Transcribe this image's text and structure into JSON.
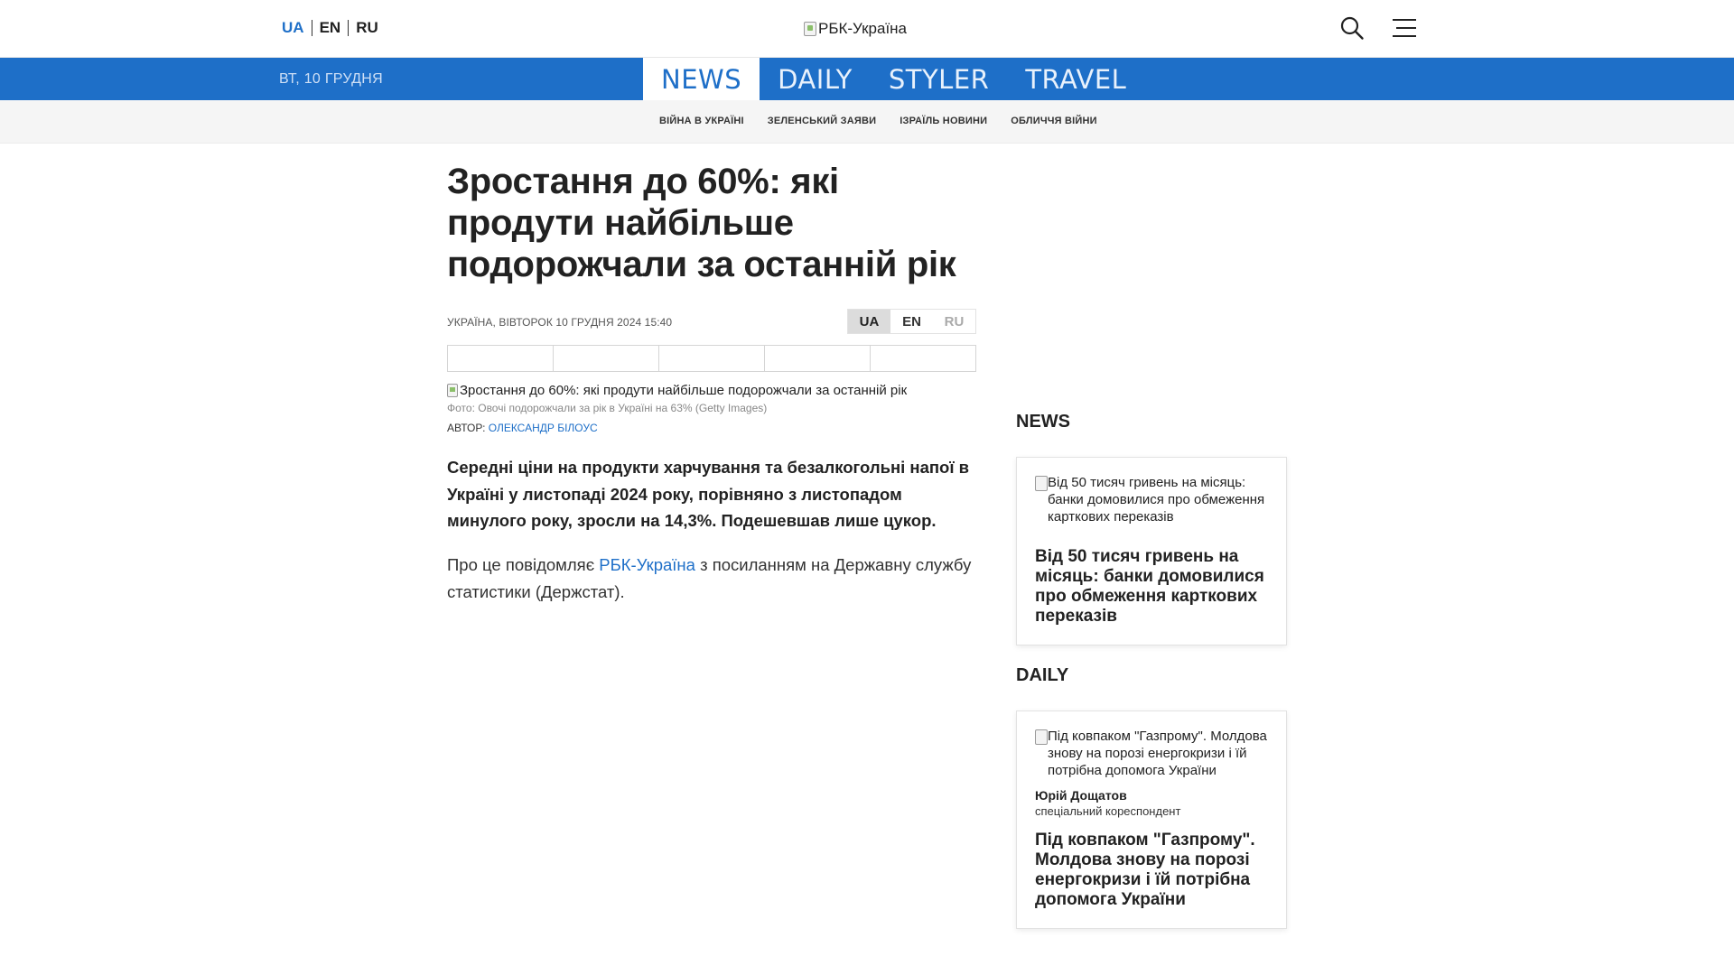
{
  "header": {
    "languages": [
      "UA",
      "EN",
      "RU"
    ],
    "active_language": "UA",
    "logo_alt": "РБК-Україна"
  },
  "nav": {
    "date": "ВТ, 10 ГРУДНЯ",
    "sections": [
      "NEWS",
      "DAILY",
      "STYLER",
      "TRAVEL"
    ],
    "active_section": "NEWS"
  },
  "subnav": {
    "links": [
      "ВІЙНА В УКРАЇНІ",
      "ЗЕЛЕНСЬКИЙ ЗАЯВИ",
      "ІЗРАЇЛЬ НОВИНИ",
      "ОБЛИЧЧЯ ВІЙНИ"
    ]
  },
  "article": {
    "headline": "Зростання до 60%: які продути найбільше подорожчали за останній рік",
    "meta": "УКРАЇНА, ВІВТОРОК 10 ГРУДНЯ 2024 15:40",
    "langs": [
      "UA",
      "EN",
      "RU"
    ],
    "photo_alt": "Зростання до 60%: які продути найбільше подорожчали за останній рік",
    "caption": "Фото: Овочі подорожчали за рік в Україні на 63% (Getty Images)",
    "author_label": "АВТОР:",
    "author_name": "ОЛЕКСАНДР БІЛОУС",
    "lead": "Середні ціни на продукти харчування та безалкогольні напої в Україні у листопаді 2024 року, порівняно з листопадом минулого року, зросли на 14,3%. Подешевшав лише цукор.",
    "para_before": "Про це повідомляє ",
    "para_link": "РБК-Україна",
    "para_after": " з посиланням на Державну службу статистики (Держстат)."
  },
  "sidebar": {
    "news_title": "NEWS",
    "news_card": {
      "img_alt": "Від 50 тисяч гривень на місяць: банки домовилися про обмеження карткових переказів",
      "title": "Від 50 тисяч гривень на місяць: банки домовилися про обмеження карткових переказів"
    },
    "daily_title": "DAILY",
    "daily_card": {
      "img_alt": "Під ковпаком \"Газпрому\". Молдова знову на порозі енергокризи і їй потрібна допомога України",
      "author": "Юрій Дощатов",
      "role": "спеціальний кореспондент",
      "title": "Під ковпаком \"Газпрому\". Молдова знову на порозі енергокризи і їй потрібна допомога України"
    }
  }
}
